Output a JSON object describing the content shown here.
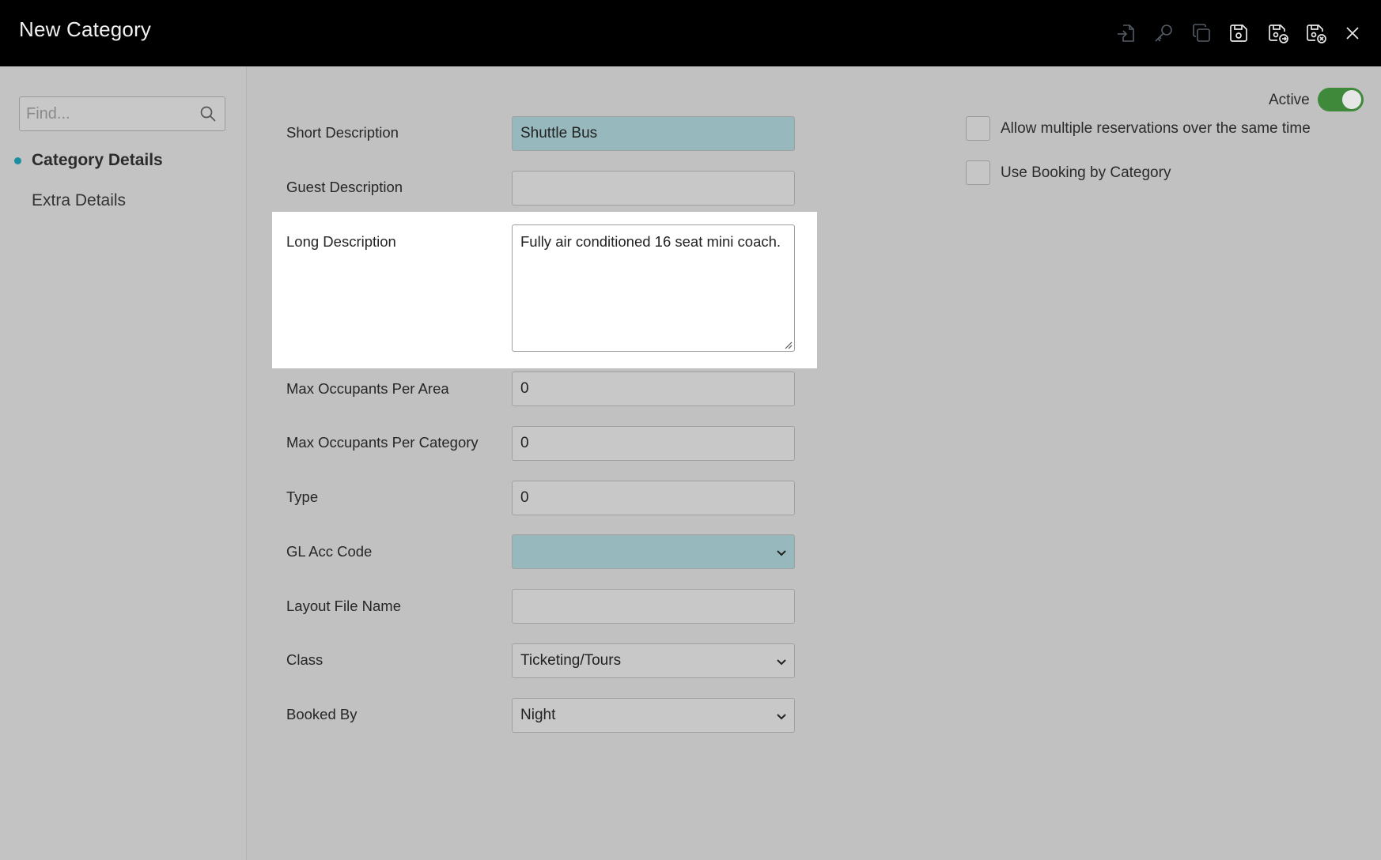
{
  "window": {
    "title": "New Category"
  },
  "toolbar": {
    "icons": [
      "import-icon",
      "key-icon",
      "copy-icon",
      "save-icon",
      "save-and-new-icon",
      "save-and-close-icon",
      "close-icon"
    ]
  },
  "sidebar": {
    "search_placeholder": "Find...",
    "items": [
      {
        "label": "Category Details",
        "active": true
      },
      {
        "label": "Extra Details",
        "active": false
      }
    ]
  },
  "form": {
    "short_description": {
      "label": "Short Description",
      "value": "Shuttle Bus"
    },
    "guest_description": {
      "label": "Guest Description",
      "value": ""
    },
    "long_description": {
      "label": "Long Description",
      "value": "Fully air conditioned 16 seat mini coach."
    },
    "max_occupants_area": {
      "label": "Max Occupants Per Area",
      "value": "0"
    },
    "max_occupants_category": {
      "label": "Max Occupants Per Category",
      "value": "0"
    },
    "type": {
      "label": "Type",
      "value": "0"
    },
    "gl_acc_code": {
      "label": "GL Acc Code",
      "value": ""
    },
    "layout_file_name": {
      "label": "Layout File Name",
      "value": ""
    },
    "class": {
      "label": "Class",
      "value": "Ticketing/Tours"
    },
    "booked_by": {
      "label": "Booked By",
      "value": "Night"
    }
  },
  "options": {
    "active_label": "Active",
    "active": true,
    "allow_multiple_label": "Allow multiple reservations over the same time",
    "allow_multiple": false,
    "use_booking_label": "Use Booking by Category",
    "use_booking": false
  },
  "colors": {
    "accent": "#1a8fa0",
    "toggle_on": "#3f8a3a",
    "required_field": "#97b8bc"
  }
}
